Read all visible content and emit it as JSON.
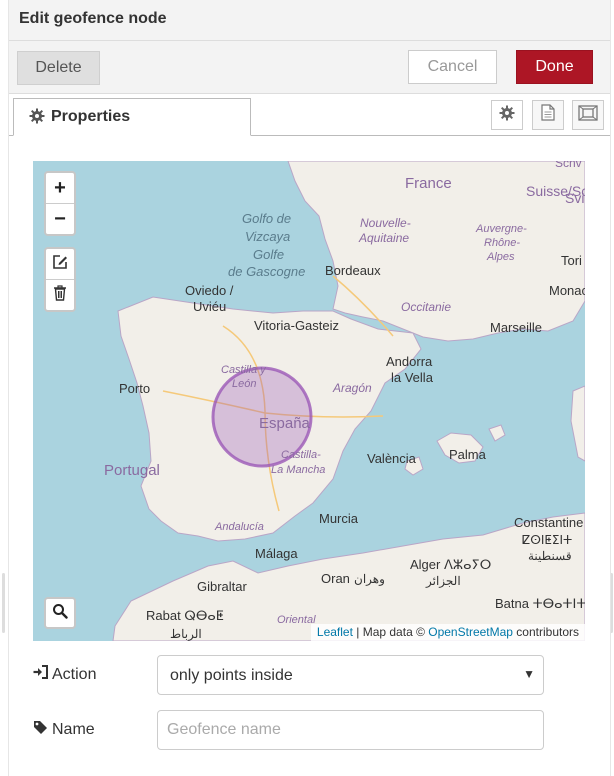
{
  "tray": {
    "title": "Edit geofence node"
  },
  "toolbar": {
    "delete_label": "Delete",
    "cancel_label": "Cancel",
    "done_label": "Done"
  },
  "colors": {
    "done": "#ad1625",
    "water": "#aad3df",
    "land": "#f2efe9",
    "geofence": "#9b59b6",
    "link": "#0078a8"
  },
  "tabs": [
    {
      "label": "Properties",
      "icon": "gear-icon"
    }
  ],
  "tab_actions": [
    {
      "icon": "gear-icon"
    },
    {
      "icon": "document-icon"
    },
    {
      "icon": "layout-icon"
    }
  ],
  "map": {
    "controls": {
      "zoom_in": "+",
      "zoom_out": "−"
    },
    "labels": [
      {
        "text": "France",
        "kind": "country"
      },
      {
        "text": "Suisse/Sc",
        "kind": "country"
      },
      {
        "text": "Svi",
        "kind": "country"
      },
      {
        "text": "Schv",
        "kind": "country"
      },
      {
        "text": "Golfo de",
        "kind": "sea"
      },
      {
        "text": "Vizcaya",
        "kind": "sea"
      },
      {
        "text": "Golfe",
        "kind": "sea"
      },
      {
        "text": "de Gascogne",
        "kind": "sea"
      },
      {
        "text": "Nouvelle-",
        "kind": "region"
      },
      {
        "text": "Aquitaine",
        "kind": "region"
      },
      {
        "text": "Auvergne-",
        "kind": "region"
      },
      {
        "text": "Rhône-",
        "kind": "region"
      },
      {
        "text": "Alpes",
        "kind": "region"
      },
      {
        "text": "Bordeaux",
        "kind": "city"
      },
      {
        "text": "Tori",
        "kind": "city"
      },
      {
        "text": "Monac",
        "kind": "city"
      },
      {
        "text": "Oviedo /",
        "kind": "city"
      },
      {
        "text": "Uviéu",
        "kind": "city"
      },
      {
        "text": "Occitanie",
        "kind": "region"
      },
      {
        "text": "Vitoria-Gasteiz",
        "kind": "city"
      },
      {
        "text": "Marseille",
        "kind": "city"
      },
      {
        "text": "Andorra",
        "kind": "city"
      },
      {
        "text": "la Vella",
        "kind": "city"
      },
      {
        "text": "Castilla y",
        "kind": "region"
      },
      {
        "text": "León",
        "kind": "region"
      },
      {
        "text": "Porto",
        "kind": "city"
      },
      {
        "text": "Aragón",
        "kind": "region"
      },
      {
        "text": "España",
        "kind": "country"
      },
      {
        "text": "Portugal",
        "kind": "country"
      },
      {
        "text": "Castilla-",
        "kind": "region"
      },
      {
        "text": "La Mancha",
        "kind": "region"
      },
      {
        "text": "València",
        "kind": "city"
      },
      {
        "text": "Palma",
        "kind": "city"
      },
      {
        "text": "Andalucía",
        "kind": "region"
      },
      {
        "text": "Murcia",
        "kind": "city"
      },
      {
        "text": "Constantine",
        "kind": "city"
      },
      {
        "text": "ⵇⵙⵏⵟⵉⵏⵜ",
        "kind": "city"
      },
      {
        "text": "قسنطينة",
        "kind": "city"
      },
      {
        "text": "Málaga",
        "kind": "city"
      },
      {
        "text": "Alger ⴷⵣⴰⵢⵔ",
        "kind": "city"
      },
      {
        "text": "الجزائر",
        "kind": "city"
      },
      {
        "text": "Gibraltar",
        "kind": "city"
      },
      {
        "text": "Oran",
        "kind": "city"
      },
      {
        "text": "وهران",
        "kind": "city"
      },
      {
        "text": "Rabat ⵕⴱⴰⵟ",
        "kind": "city"
      },
      {
        "text": "الرباط",
        "kind": "city"
      },
      {
        "text": "Oriental",
        "kind": "region"
      },
      {
        "text": "Batna ⵜⴱⴰⵜⵏⵜ",
        "kind": "city"
      }
    ],
    "attribution": {
      "leaflet": "Leaflet",
      "sep": " | Map data © ",
      "osm": "OpenStreetMap",
      "tail": " contributors"
    }
  },
  "form": {
    "action": {
      "label": "Action",
      "value": "only points inside"
    },
    "name": {
      "label": "Name",
      "value": "",
      "placeholder": "Geofence name"
    }
  }
}
